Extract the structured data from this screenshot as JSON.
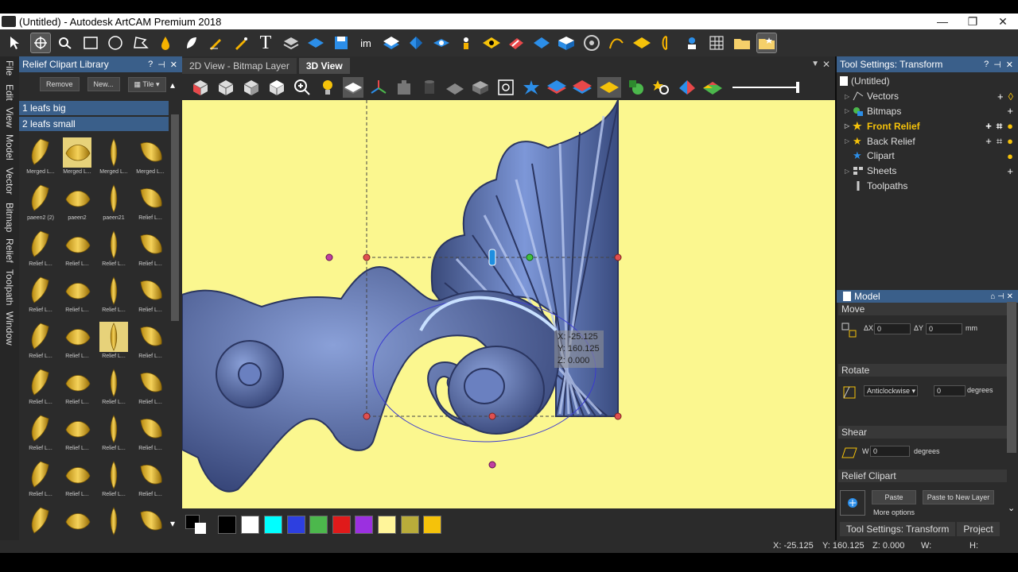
{
  "titlebar": {
    "title": "(Untitled) - Autodesk ArtCAM Premium 2018",
    "min": "—",
    "max": "❐",
    "close": "✕"
  },
  "toolbar1": {
    "tools": [
      "select-pointer",
      "transform-move",
      "zoom-lens",
      "rectangle",
      "ellipse",
      "polyline",
      "drop",
      "leaf",
      "pen",
      "brush",
      "text",
      "stack",
      "diamond",
      "save",
      "im",
      "layers-blue",
      "shape-blue",
      "shape2-blue",
      "person",
      "lozenge-yellow",
      "eraser-red",
      "diamond-blue",
      "box-blue",
      "gear-circle",
      "curve-tool",
      "lozenge2-yellow",
      "half-shape",
      "relief-tool",
      "grid-tool",
      "folder",
      "folder-star"
    ],
    "im_label": "im"
  },
  "vertical_tabs": [
    "File",
    "Edit",
    "View",
    "Model",
    "Vector",
    "Bitmap",
    "Relief",
    "Toolpath",
    "Window"
  ],
  "library": {
    "title": "Relief Clipart Library",
    "remove": "Remove",
    "new": "New...",
    "tile": "Tile",
    "groups": [
      "1 leafs big",
      "2 leafs small"
    ],
    "thumbs": [
      "Merged L...",
      "Merged L...",
      "Merged L...",
      "Merged L...",
      "paeen2 (2)",
      "paeen2",
      "paeen21",
      "Relief L...",
      "Relief L...",
      "Relief L...",
      "Relief L...",
      "Relief L...",
      "Relief L...",
      "Relief L...",
      "Relief L...",
      "Relief L...",
      "Relief L...",
      "Relief L...",
      "Relief L...",
      "Relief L...",
      "Relief L...",
      "Relief L...",
      "Relief L...",
      "Relief L...",
      "Relief L...",
      "Relief L...",
      "Relief L...",
      "Relief L...",
      "Relief L...",
      "Relief L...",
      "Relief L...",
      "Relief L...",
      "",
      "",
      "",
      ""
    ],
    "selected_indices": [
      1,
      18
    ]
  },
  "view_tabs": {
    "tab1": "2D View - Bitmap Layer",
    "tab2": "3D View",
    "close": "✕"
  },
  "cursor_readout": {
    "x": "X: -25.125",
    "y": "Y: 160.125",
    "z": "Z: 0.000"
  },
  "palette": {
    "colors": [
      "#000000",
      "#ffffff",
      "#00ffff",
      "#2d3fe0",
      "#4cb84c",
      "#e01a1a",
      "#9b30e0",
      "#fff59a",
      "#b9ac3a",
      "#f5c20a"
    ]
  },
  "tool_settings": {
    "title": "Tool Settings: Transform",
    "tree": [
      {
        "label": "(Untitled)",
        "icon": "document-icon"
      },
      {
        "label": "Vectors",
        "icon": "vector-icon"
      },
      {
        "label": "Bitmaps",
        "icon": "bitmap-icon"
      },
      {
        "label": "Front Relief",
        "icon": "star-icon"
      },
      {
        "label": "Back Relief",
        "icon": "star-icon"
      },
      {
        "label": "Clipart",
        "icon": "clipart-star-icon"
      },
      {
        "label": "Sheets",
        "icon": "sheets-icon"
      },
      {
        "label": "Toolpaths",
        "icon": "toolpaths-icon"
      }
    ]
  },
  "model": {
    "title": "Model",
    "move": "Move",
    "dx_label": "ΔX",
    "dx": "0",
    "dy_label": "ΔY",
    "dy": "0",
    "mm": "mm",
    "rotate": "Rotate",
    "rotate_dir": "Anticlockwise",
    "rotate_val": "0",
    "degrees": "degrees",
    "shear": "Shear",
    "shear_w_label": "W",
    "shear_w": "0",
    "shear_degrees": "degrees",
    "relief_clipart": "Relief Clipart",
    "paste": "Paste",
    "paste_new": "Paste to New Layer",
    "more_options": "More options"
  },
  "bottom_tabs": {
    "tab1": "Tool Settings: Transform",
    "tab2": "Project"
  },
  "status": {
    "x": "X: -25.125",
    "y": "Y: 160.125",
    "z": "Z: 0.000",
    "w": "W:",
    "h": "H:"
  }
}
